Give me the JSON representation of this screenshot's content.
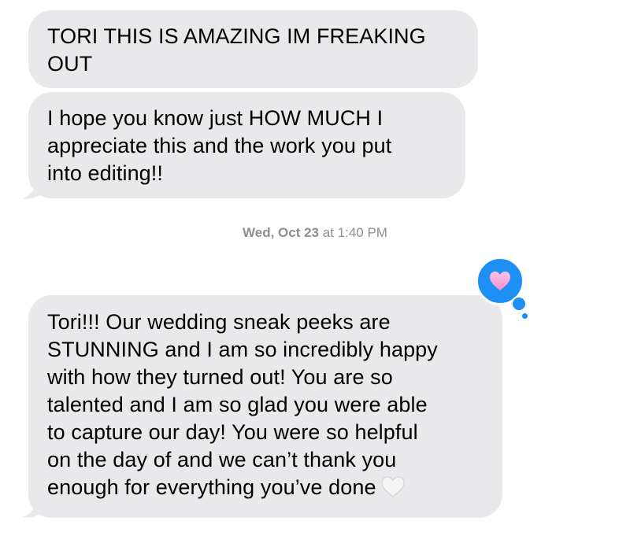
{
  "messages": [
    {
      "lines": [
        "TORI THIS IS AMAZING IM FREAKING",
        "OUT"
      ]
    },
    {
      "lines": [
        "I hope you know just HOW MUCH I",
        "appreciate this and the work you put",
        "into editing!!"
      ]
    },
    {
      "lines": [
        "Tori!!! Our wedding sneak peeks are",
        "STUNNING and I am so incredibly happy",
        "with how they turned out! You are so",
        "talented and I am so glad you were able",
        "to capture our day! You were so helpful",
        "on the day of and we can’t thank you",
        "enough for everything you’ve done"
      ],
      "trailing_emoji": "white-heart-icon",
      "reaction": "pink-heart-icon"
    }
  ],
  "timestamp": {
    "date": "Wed, Oct 23",
    "time": "at 1:40 PM"
  },
  "colors": {
    "bubble": "#e9e9eb",
    "reaction_blue": "#1e8ff5",
    "timestamp": "#8e8e93",
    "heart_pink": "#f7a3d6"
  }
}
